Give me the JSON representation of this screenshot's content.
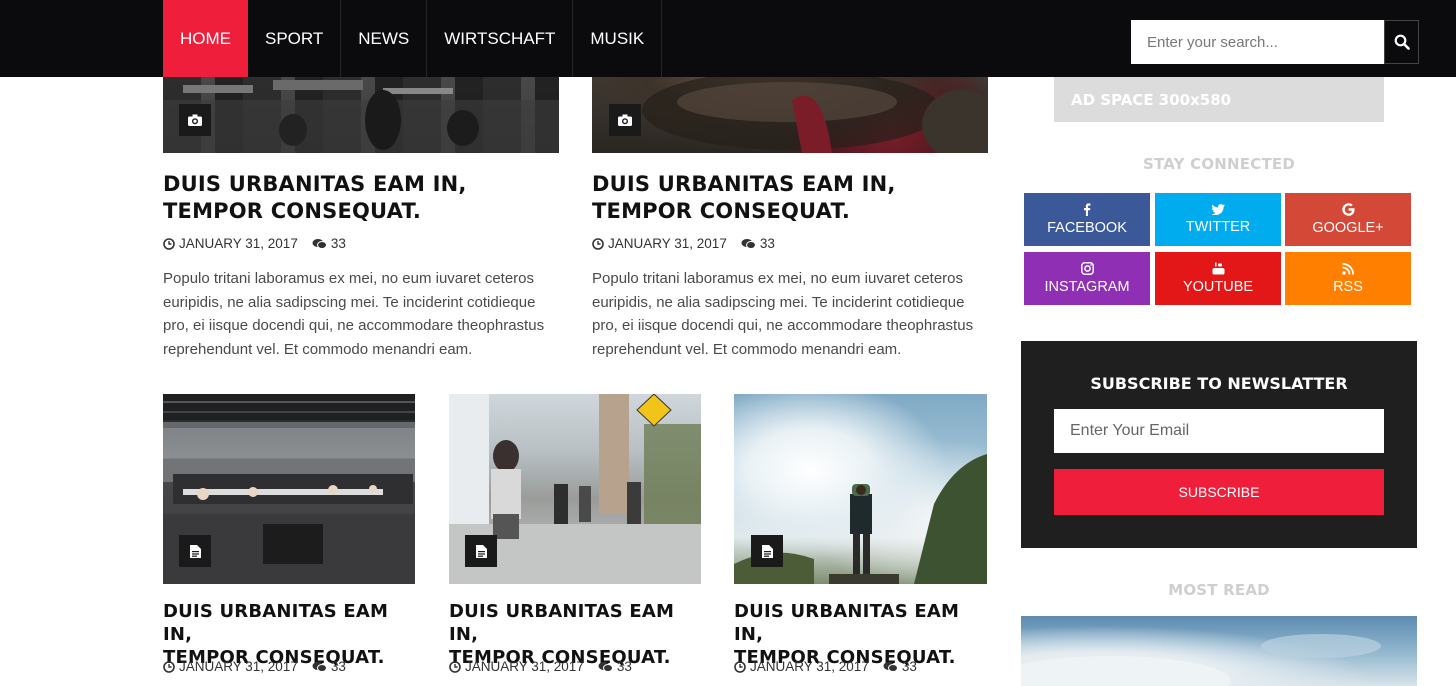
{
  "nav": {
    "items": [
      "HOME",
      "SPORT",
      "NEWS",
      "WIRTSCHAFT",
      "MUSIK"
    ],
    "active": "HOME"
  },
  "search": {
    "placeholder": "Enter your search..."
  },
  "featured": [
    {
      "title_line1": "DUIS URBANITAS EAM IN,",
      "title_line2": "TEMPOR CONSEQUAT.",
      "date": "JANUARY 31, 2017",
      "comments": "33",
      "excerpt": [
        "Populo tritani laboramus ex mei, no eum iuvaret ceteros",
        "euripidis, ne alia sadipscing mei. Te inciderint cotidieque",
        "pro, ei iisque docendi qui, ne accommodare theophrastus",
        "reprehendunt vel. Et commodo menandri eam."
      ],
      "badge_icon": "camera-icon"
    },
    {
      "title_line1": "DUIS URBANITAS EAM IN,",
      "title_line2": "TEMPOR CONSEQUAT.",
      "date": "JANUARY 31, 2017",
      "comments": "33",
      "excerpt": [
        "Populo tritani laboramus ex mei, no eum iuvaret ceteros",
        "euripidis, ne alia sadipscing mei. Te inciderint cotidieque",
        "pro, ei iisque docendi qui, ne accommodare theophrastus",
        "reprehendunt vel. Et commodo menandri eam."
      ],
      "badge_icon": "camera-icon"
    }
  ],
  "grid": [
    {
      "title_line1": "DUIS URBANITAS EAM IN,",
      "title_line2": "TEMPOR CONSEQUAT.",
      "date": "JANUARY 31, 2017",
      "comments": "33",
      "badge_icon": "document-icon"
    },
    {
      "title_line1": "DUIS URBANITAS EAM IN,",
      "title_line2": "TEMPOR CONSEQUAT.",
      "date": "JANUARY 31, 2017",
      "comments": "33",
      "badge_icon": "document-icon"
    },
    {
      "title_line1": "DUIS URBANITAS EAM IN,",
      "title_line2": "TEMPOR CONSEQUAT.",
      "date": "JANUARY 31, 2017",
      "comments": "33",
      "badge_icon": "document-icon"
    }
  ],
  "sidebar": {
    "ad_label": "AD SPACE 300x580",
    "stay_connected": "STAY CONNECTED",
    "social": [
      {
        "label": "FACEBOOK",
        "icon": "facebook-icon",
        "color": "#3b5998"
      },
      {
        "label": "TWITTER",
        "icon": "twitter-icon",
        "color": "#00aced"
      },
      {
        "label": "GOOGLE+",
        "icon": "google-plus-icon",
        "color": "#d34836"
      },
      {
        "label": "INSTAGRAM",
        "icon": "instagram-icon",
        "color": "#8e2fb4"
      },
      {
        "label": "YOUTUBE",
        "icon": "youtube-icon",
        "color": "#e31717"
      },
      {
        "label": "RSS",
        "icon": "rss-icon",
        "color": "#ff7f00"
      }
    ],
    "newsletter": {
      "title": "SUBSCRIBE TO NEWSLATTER",
      "placeholder": "Enter Your Email",
      "button": "SUBSCRIBE"
    },
    "most_read": "MOST READ"
  },
  "colors": {
    "accent": "#ef1f3c",
    "topbar": "#0b0b0d",
    "newsletter_bg": "#1f1f20"
  }
}
